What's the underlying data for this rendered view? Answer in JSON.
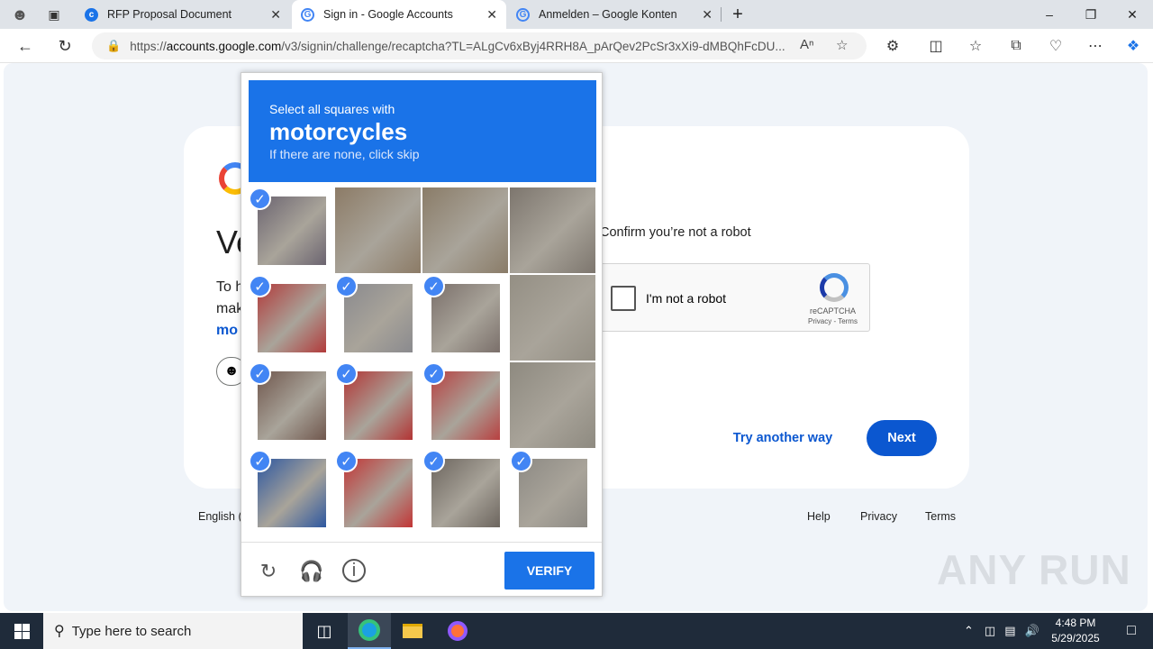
{
  "browser": {
    "tabs": [
      {
        "title": "RFP Proposal Document",
        "icon": "page-icon"
      },
      {
        "title": "Sign in - Google Accounts",
        "icon": "google-icon"
      },
      {
        "title": "Anmelden – Google Konten",
        "icon": "google-icon"
      }
    ],
    "new_tab": "+",
    "url_host": "accounts.google.com",
    "url_scheme": "https://",
    "url_path": "/v3/signin/challenge/recaptcha?TL=ALgCv6xByj4RRH8A_pArQev2PcSr3xXi9-dMBQhFcDU..."
  },
  "page": {
    "title": "Ve",
    "text_line1": "To h",
    "text_line2": "mak",
    "link": "mo",
    "confirm": "Confirm you’re not a robot",
    "recaptcha_label": "I'm not a robot",
    "recaptcha_name": "reCAPTCHA",
    "recaptcha_terms": "Privacy - Terms",
    "try_another": "Try another way",
    "next": "Next",
    "footer_lang": "English (",
    "footer_help": "Help",
    "footer_privacy": "Privacy",
    "footer_terms": "Terms"
  },
  "captcha": {
    "line1": "Select all squares with",
    "object": "motorcycles",
    "line3": "If there are none, click skip",
    "verify": "VERIFY",
    "tile_colors": [
      "#6b6470",
      "#8c7b66",
      "#8a7c68",
      "#7d766e",
      "#b23a3a",
      "#8a8a8e",
      "#7a6f6a",
      "#948f84",
      "#70574d",
      "#b33434",
      "#b84040",
      "#8e8a80",
      "#2d57a0",
      "#c23535",
      "#6c655e",
      "#8d8a84"
    ]
  },
  "watermark": "ANY RUN",
  "taskbar": {
    "search_placeholder": "Type here to search",
    "time": "4:48 PM",
    "date": "5/29/2025"
  }
}
